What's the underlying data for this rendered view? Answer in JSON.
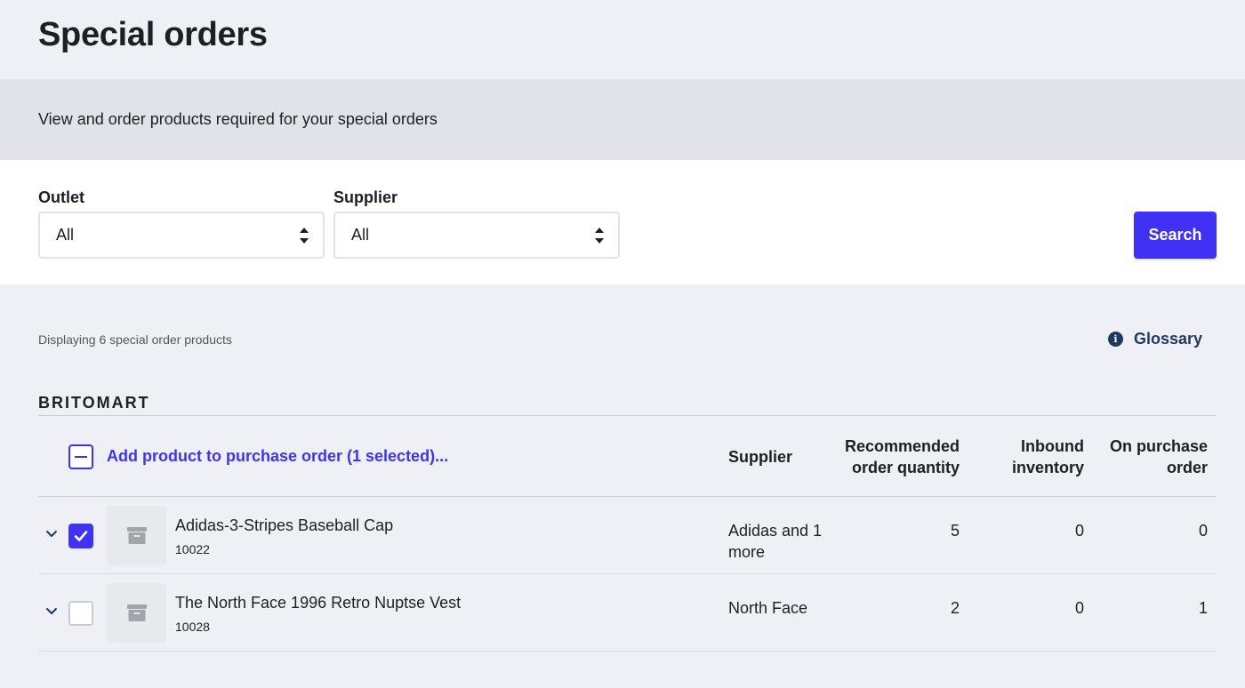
{
  "page": {
    "title": "Special orders",
    "description": "View and order products required for your special orders"
  },
  "filters": {
    "outlet": {
      "label": "Outlet",
      "value": "All"
    },
    "supplier": {
      "label": "Supplier",
      "value": "All"
    },
    "search_label": "Search"
  },
  "results": {
    "count_text": "Displaying 6 special order products",
    "glossary_label": "Glossary",
    "glossary_icon": "info-icon"
  },
  "group": {
    "title": "BRITOMART",
    "bulk_action": "Add product to purchase order (1 selected)...",
    "columns": {
      "supplier": "Supplier",
      "recommended_line1": "Recommended",
      "recommended_line2": "order quantity",
      "inbound_line1": "Inbound",
      "inbound_line2": "inventory",
      "po_line1": "On purchase",
      "po_line2": "order"
    },
    "rows": [
      {
        "name": "Adidas-3-Stripes Baseball Cap",
        "sku": "10022",
        "supplier": "Adidas and 1 more",
        "recommended": "5",
        "inbound": "0",
        "on_po": "0",
        "selected": true
      },
      {
        "name": "The North Face 1996 Retro Nuptse Vest",
        "sku": "10028",
        "supplier": "North Face",
        "recommended": "2",
        "inbound": "0",
        "on_po": "1",
        "selected": false
      }
    ]
  },
  "colors": {
    "accent": "#3f32f5",
    "link_dark": "#1e3a5f",
    "background": "#eff0f5",
    "banner": "#e2e3e8"
  }
}
